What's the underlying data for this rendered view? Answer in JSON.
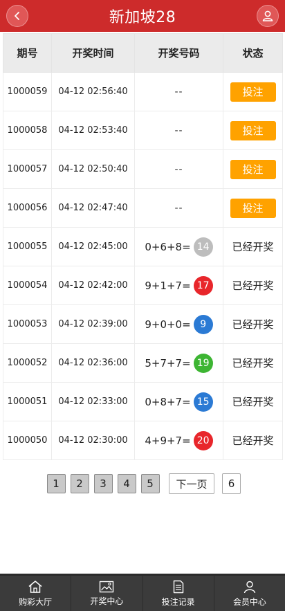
{
  "header": {
    "title": "新加坡28",
    "back_icon": "chevron-left-icon",
    "user_icon": "user-icon"
  },
  "table": {
    "headers": [
      "期号",
      "开奖时间",
      "开奖号码",
      "状态"
    ],
    "rows": [
      {
        "issue": "1000059",
        "time": "04-12 02:56:40",
        "formula": "",
        "result": "",
        "result_color": "",
        "status": "投注",
        "pending": true
      },
      {
        "issue": "1000058",
        "time": "04-12 02:53:40",
        "formula": "",
        "result": "",
        "result_color": "",
        "status": "投注",
        "pending": true
      },
      {
        "issue": "1000057",
        "time": "04-12 02:50:40",
        "formula": "",
        "result": "",
        "result_color": "",
        "status": "投注",
        "pending": true
      },
      {
        "issue": "1000056",
        "time": "04-12 02:47:40",
        "formula": "",
        "result": "",
        "result_color": "",
        "status": "投注",
        "pending": true
      },
      {
        "issue": "1000055",
        "time": "04-12 02:45:00",
        "formula": "0+6+8=",
        "result": "14",
        "result_color": "#bdbdbd",
        "status": "已经开奖",
        "pending": false
      },
      {
        "issue": "1000054",
        "time": "04-12 02:42:00",
        "formula": "9+1+7=",
        "result": "17",
        "result_color": "#e8262b",
        "status": "已经开奖",
        "pending": false
      },
      {
        "issue": "1000053",
        "time": "04-12 02:39:00",
        "formula": "9+0+0=",
        "result": "9",
        "result_color": "#2b7ad4",
        "status": "已经开奖",
        "pending": false
      },
      {
        "issue": "1000052",
        "time": "04-12 02:36:00",
        "formula": "5+7+7=",
        "result": "19",
        "result_color": "#3db533",
        "status": "已经开奖",
        "pending": false
      },
      {
        "issue": "1000051",
        "time": "04-12 02:33:00",
        "formula": "0+8+7=",
        "result": "15",
        "result_color": "#2b7ad4",
        "status": "已经开奖",
        "pending": false
      },
      {
        "issue": "1000050",
        "time": "04-12 02:30:00",
        "formula": "4+9+7=",
        "result": "20",
        "result_color": "#e8262b",
        "status": "已经开奖",
        "pending": false
      }
    ],
    "pending_placeholder": "--"
  },
  "pager": {
    "pages": [
      "1",
      "2",
      "3",
      "4",
      "5"
    ],
    "next_label": "下一页",
    "last_page": "6"
  },
  "footer": {
    "tabs": [
      {
        "label": "购彩大厅",
        "icon": "home-icon"
      },
      {
        "label": "开奖中心",
        "icon": "image-icon"
      },
      {
        "label": "投注记录",
        "icon": "document-icon"
      },
      {
        "label": "会员中心",
        "icon": "user-icon"
      }
    ]
  },
  "colors": {
    "header_bg": "#cd2b2b",
    "bet_button": "#ffa200",
    "footer_bg": "#3b3b3b"
  }
}
